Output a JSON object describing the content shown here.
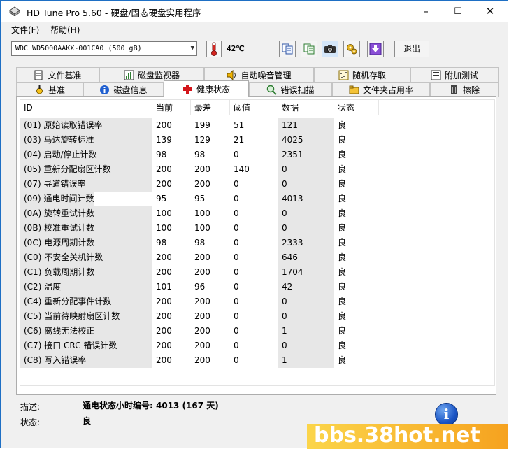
{
  "window": {
    "title": "HD Tune Pro 5.60 - 硬盘/固态硬盘实用程序",
    "minimize": "–",
    "maximize": "☐",
    "close": "✕"
  },
  "menu": [
    {
      "label": "文件(F)"
    },
    {
      "label": "帮助(H)"
    }
  ],
  "toolbar": {
    "drive": "WDC WD5000AAKX-001CA0 (500 gB)",
    "temperature": "42℃",
    "exit_label": "退出"
  },
  "tabs_top": [
    {
      "label": "文件基准",
      "icon": "file-benchmark-icon"
    },
    {
      "label": "磁盘监视器",
      "icon": "disk-monitor-icon"
    },
    {
      "label": "自动噪音管理",
      "icon": "speaker-icon"
    },
    {
      "label": "随机存取",
      "icon": "random-access-icon"
    },
    {
      "label": "附加测试",
      "icon": "extra-tests-icon"
    }
  ],
  "tabs_bottom": [
    {
      "label": "基准",
      "icon": "benchmark-icon"
    },
    {
      "label": "磁盘信息",
      "icon": "info-icon"
    },
    {
      "label": "健康状态",
      "icon": "red-cross-icon"
    },
    {
      "label": "错误扫描",
      "icon": "magnifier-icon"
    },
    {
      "label": "文件夹占用率",
      "icon": "folder-icon"
    },
    {
      "label": "擦除",
      "icon": "eraser-icon"
    }
  ],
  "columns": [
    "ID",
    "当前",
    "最差",
    "阈值",
    "数据",
    "状态"
  ],
  "rows": [
    {
      "id": "(01) 原始读取错误率",
      "current": "200",
      "worst": "199",
      "threshold": "51",
      "data": "121",
      "status": "良"
    },
    {
      "id": "(03) 马达旋转标准",
      "current": "139",
      "worst": "129",
      "threshold": "21",
      "data": "4025",
      "status": "良"
    },
    {
      "id": "(04) 启动/停止计数",
      "current": "98",
      "worst": "98",
      "threshold": "0",
      "data": "2351",
      "status": "良"
    },
    {
      "id": "(05) 重新分配扇区计数",
      "current": "200",
      "worst": "200",
      "threshold": "140",
      "data": "0",
      "status": "良"
    },
    {
      "id": "(07) 寻道错误率",
      "current": "200",
      "worst": "200",
      "threshold": "0",
      "data": "0",
      "status": "良"
    },
    {
      "id": "(09) 通电时间计数",
      "current": "95",
      "worst": "95",
      "threshold": "0",
      "data": "4013",
      "status": "良"
    },
    {
      "id": "(0A) 旋转重试计数",
      "current": "100",
      "worst": "100",
      "threshold": "0",
      "data": "0",
      "status": "良"
    },
    {
      "id": "(0B) 校准重试计数",
      "current": "100",
      "worst": "100",
      "threshold": "0",
      "data": "0",
      "status": "良"
    },
    {
      "id": "(0C) 电源周期计数",
      "current": "98",
      "worst": "98",
      "threshold": "0",
      "data": "2333",
      "status": "良"
    },
    {
      "id": "(C0) 不安全关机计数",
      "current": "200",
      "worst": "200",
      "threshold": "0",
      "data": "646",
      "status": "良"
    },
    {
      "id": "(C1) 负载周期计数",
      "current": "200",
      "worst": "200",
      "threshold": "0",
      "data": "1704",
      "status": "良"
    },
    {
      "id": "(C2) 温度",
      "current": "101",
      "worst": "96",
      "threshold": "0",
      "data": "42",
      "status": "良"
    },
    {
      "id": "(C4) 重新分配事件计数",
      "current": "200",
      "worst": "200",
      "threshold": "0",
      "data": "0",
      "status": "良"
    },
    {
      "id": "(C5) 当前待映射扇区计数",
      "current": "200",
      "worst": "200",
      "threshold": "0",
      "data": "0",
      "status": "良"
    },
    {
      "id": "(C6) 离线无法校正",
      "current": "200",
      "worst": "200",
      "threshold": "0",
      "data": "1",
      "status": "良"
    },
    {
      "id": "(C7) 接口 CRC 错误计数",
      "current": "200",
      "worst": "200",
      "threshold": "0",
      "data": "0",
      "status": "良"
    },
    {
      "id": "(C8) 写入错误率",
      "current": "200",
      "worst": "200",
      "threshold": "0",
      "data": "1",
      "status": "良"
    }
  ],
  "status_area": {
    "desc_label": "描述:",
    "desc_value": "通电状态小时编号: 4013 (167 天)",
    "status_label": "状态:",
    "status_value": "良"
  },
  "watermark": "bbs.38hot.net",
  "colors": {
    "accent": "#2a6fc9",
    "row_shade": "#e7e7e7",
    "watermark": "#f6a21f"
  }
}
